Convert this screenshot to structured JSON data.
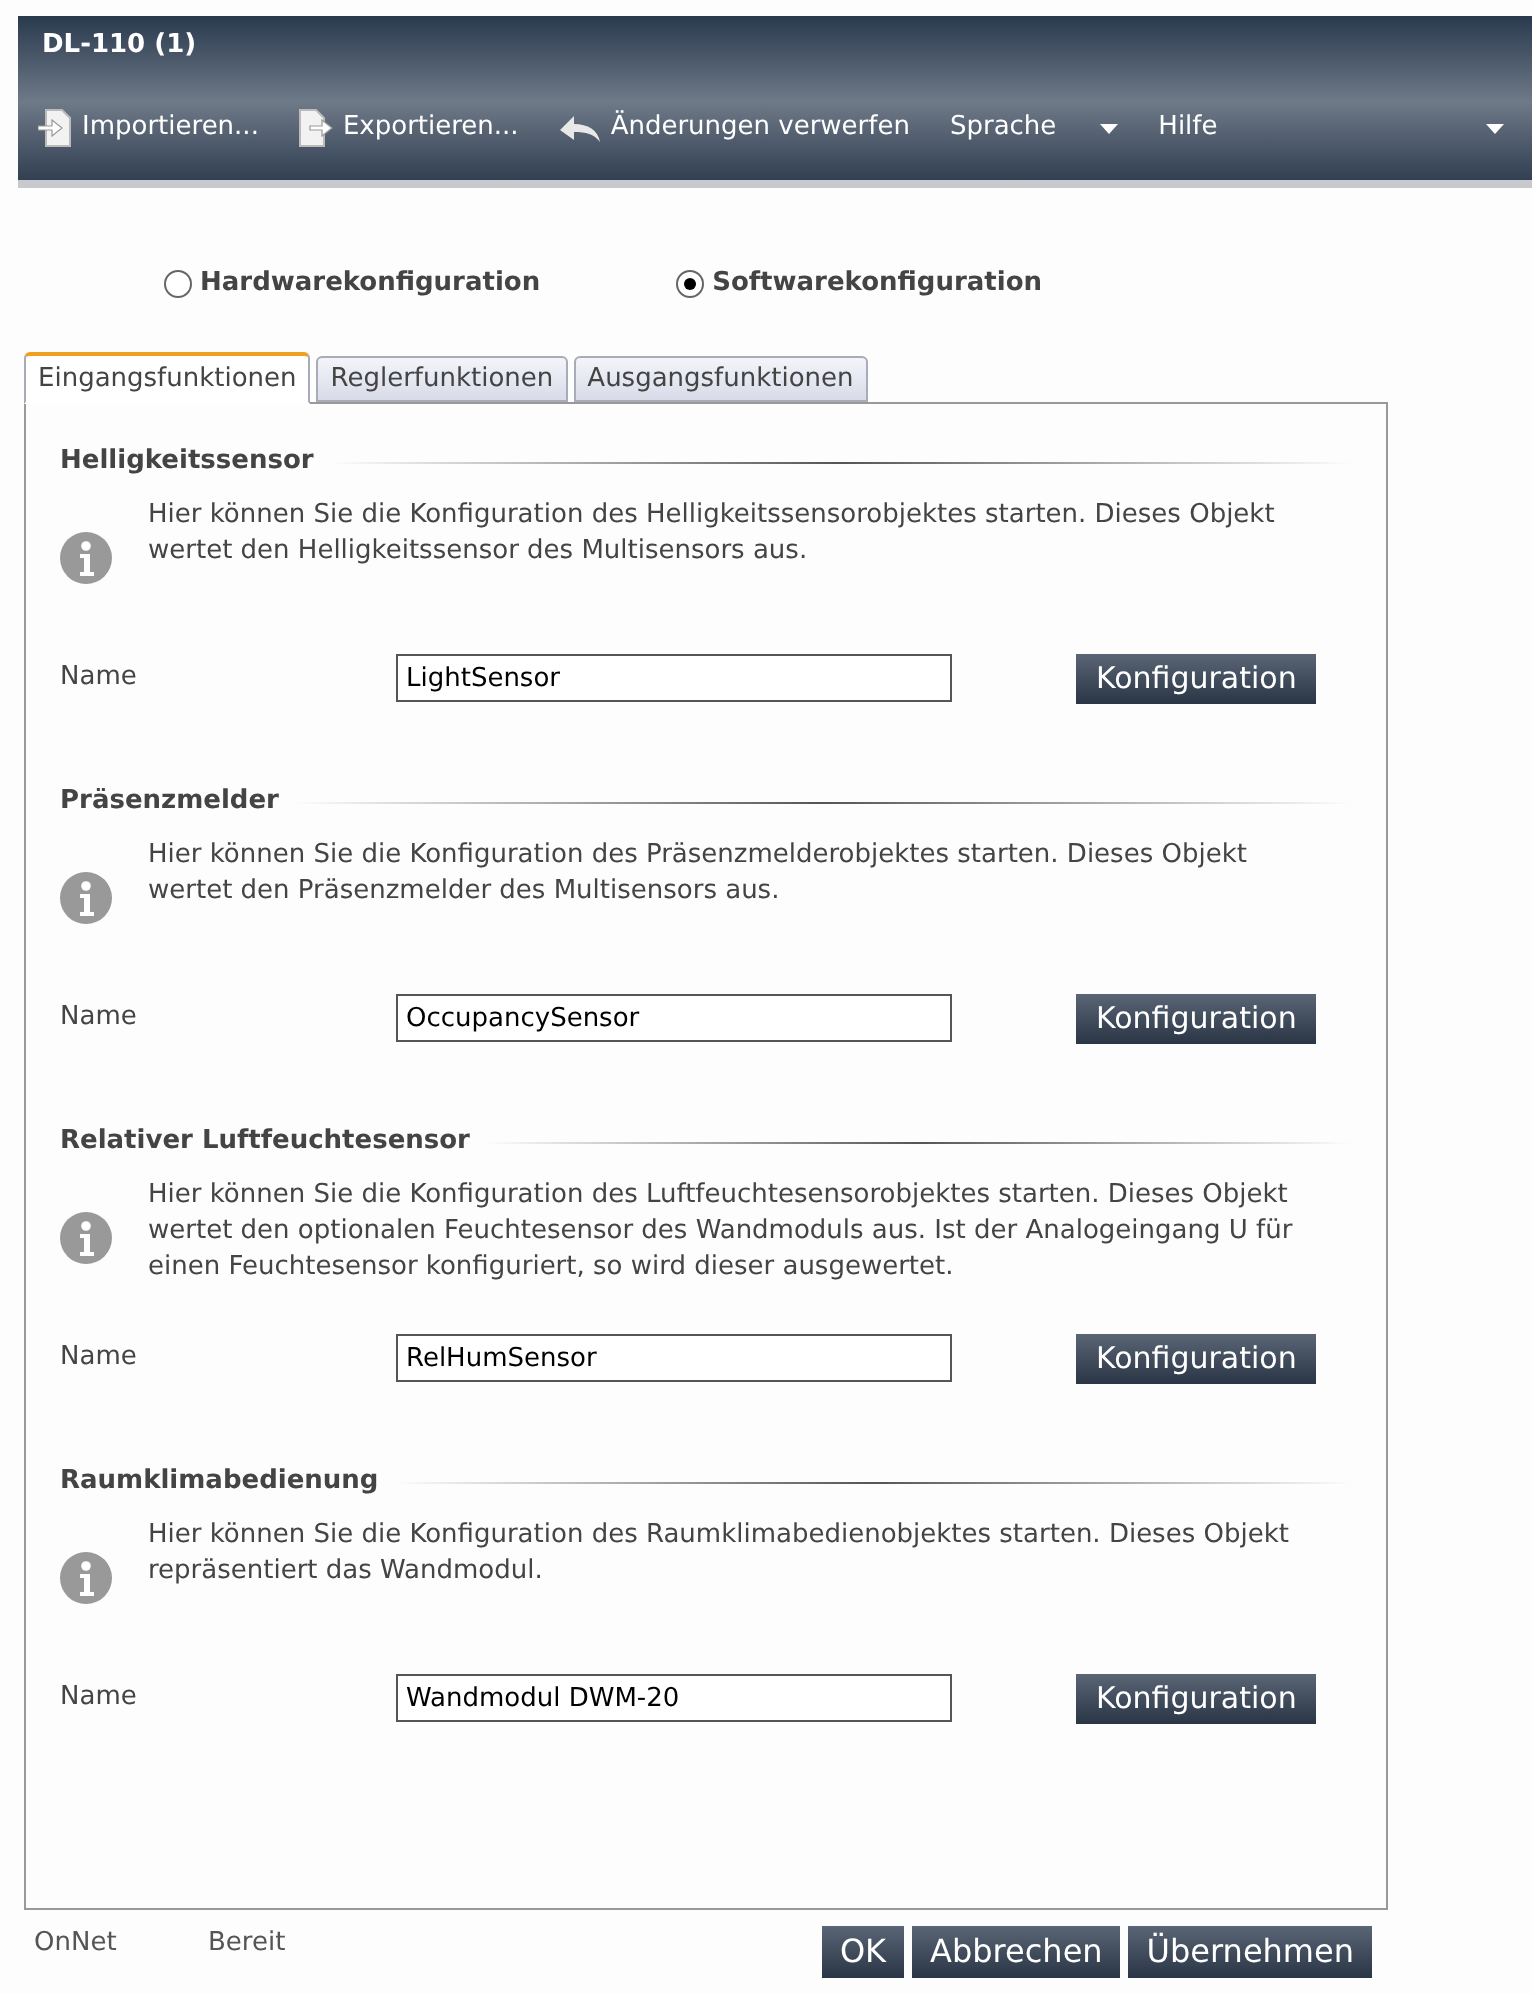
{
  "window": {
    "title": "DL-110 (1)"
  },
  "toolbar": [
    {
      "label": "Importieren...",
      "kind": "import"
    },
    {
      "label": "Exportieren...",
      "kind": "export"
    },
    {
      "label": "Änderungen verwerfen",
      "kind": "undo"
    },
    {
      "label": "Sprache",
      "kind": "menu"
    },
    {
      "label": "Hilfe",
      "kind": "menu"
    }
  ],
  "mode": [
    {
      "label": "Hardwarekonfiguration",
      "selected": false
    },
    {
      "label": "Softwarekonfiguration",
      "selected": true
    }
  ],
  "tabs": [
    {
      "label": "Eingangsfunktionen",
      "selected": true
    },
    {
      "label": "Reglerfunktionen",
      "selected": false
    },
    {
      "label": "Ausgangsfunktionen",
      "selected": false
    }
  ],
  "sections": [
    {
      "title": "Helligkeitssensor",
      "info": "Hier können Sie die Konfiguration des Helligkeitssensorobjektes starten. Dieses Objekt wertet den Helligkeitssensor des Multisensors aus.",
      "name_label": "Name",
      "name_value": "LightSensor",
      "button": "Konfiguration"
    },
    {
      "title": "Präsenzmelder",
      "info": "Hier können Sie die Konfiguration des Präsenzmelderobjektes starten. Dieses Objekt wertet den Präsenzmelder des Multisensors aus.",
      "name_label": "Name",
      "name_value": "OccupancySensor",
      "button": "Konfiguration"
    },
    {
      "title": "Relativer Luftfeuchtesensor",
      "info": "Hier können Sie die Konfiguration des Luftfeuchtesensorobjektes starten. Dieses Objekt wertet den optionalen Feuchtesensor des Wandmoduls aus. Ist der Analogeingang U für einen Feuchtesensor konfiguriert, so wird dieser ausgewertet.",
      "name_label": "Name",
      "name_value": "RelHumSensor",
      "button": "Konfiguration"
    },
    {
      "title": "Raumklimabedienung",
      "info": "Hier können Sie die Konfiguration des Raumklimabedienobjektes starten. Dieses Objekt repräsentiert das Wandmodul.",
      "name_label": "Name",
      "name_value": "Wandmodul DWM-20",
      "button": "Konfiguration"
    }
  ],
  "status_bar": {
    "items": [
      "OnNet",
      "Bereit"
    ]
  },
  "buttons": [
    "OK",
    "Abbrechen",
    "Übernehmen"
  ]
}
